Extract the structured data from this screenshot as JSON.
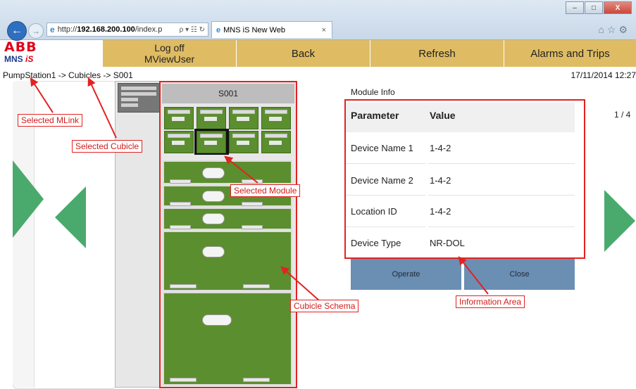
{
  "browser": {
    "url_prefix": "http://",
    "url_host": "192.168.200.100",
    "url_path": "/index.p",
    "address_tools": "ρ ▾ ☷ ↻",
    "tab_title": "MNS iS New Web",
    "tab_close": "×",
    "window_minimize": "–",
    "window_maximize": "□",
    "window_close": "X",
    "toolbar_icons": "⌂☆⚙"
  },
  "logo": {
    "brand": "ABB",
    "product_prefix": "MNS ",
    "product_suffix": "iS"
  },
  "header": {
    "logoff_line1": "Log off",
    "logoff_line2": "MViewUser",
    "back_label": "Back",
    "refresh_label": "Refresh",
    "alarms_label": "Alarms and Trips"
  },
  "breadcrumb": "PumpStation1 -> Cubicles -> S001",
  "datetime": "17/11/2014 12:27",
  "cubicle": {
    "name": "S001"
  },
  "module_info": {
    "title": "Module Info",
    "page": "1 / 4",
    "headers": {
      "parameter": "Parameter",
      "value": "Value"
    },
    "rows": [
      {
        "parameter": "Device Name 1",
        "value": "1-4-2"
      },
      {
        "parameter": "Device Name 2",
        "value": "1-4-2"
      },
      {
        "parameter": "Location ID",
        "value": "1-4-2"
      },
      {
        "parameter": "Device Type",
        "value": "NR-DOL"
      }
    ],
    "operate_label": "Operate",
    "close_label": "Close"
  },
  "annotations": {
    "selected_mlink": "Selected MLink",
    "selected_cubicle": "Selected Cubicle",
    "selected_module": "Selected Module",
    "cubicle_schema": "Cubicle Schema",
    "information_area": "Information Area"
  },
  "colors": {
    "accent_button": "#dfbc64",
    "nav_arrow": "#4aaa6d",
    "module_green": "#5b8e2e",
    "action_button": "#6b8eb3",
    "annotation_red": "#e32222"
  }
}
